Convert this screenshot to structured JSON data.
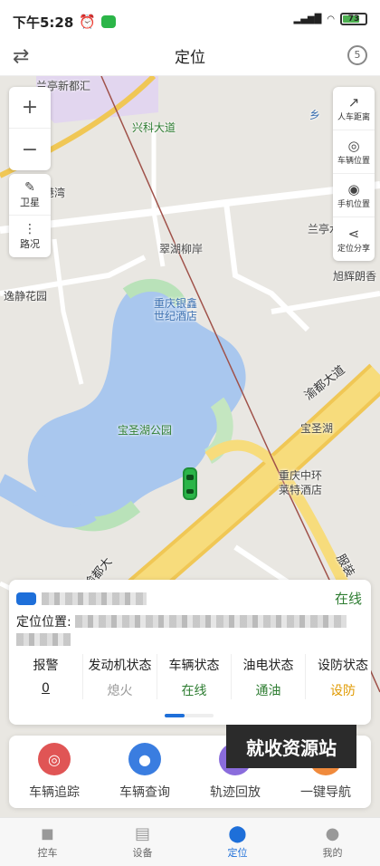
{
  "status_bar": {
    "time": "下午5:28",
    "battery": "73"
  },
  "header": {
    "title": "定位",
    "timer": "5"
  },
  "map_controls": {
    "zoom_in": "+",
    "zoom_out": "−",
    "satellite": "卫星",
    "traffic": "路况"
  },
  "map_right": [
    {
      "label": "人车距离"
    },
    {
      "label": "车辆位置"
    },
    {
      "label": "手机位置"
    },
    {
      "label": "定位分享"
    }
  ],
  "map_labels": {
    "l1": "兰亭新都汇",
    "l2": "兴科大道",
    "l3": "城市港湾",
    "l4": "翠湖柳岸",
    "l5": "兰亭水",
    "l6": "旭辉朗香",
    "l7": "逸静花园",
    "l8": "重庆银鑫",
    "l9": "世纪酒店",
    "l10": "宝圣湖公园",
    "l11": "宝圣湖",
    "l12": "渝都大道",
    "l13": "重庆中环",
    "l14": "莱特酒店",
    "l15": "渝都大",
    "l16": "服装",
    "l17": "乡"
  },
  "info": {
    "status": "在线",
    "location_label": "定位位置:"
  },
  "stats": [
    {
      "label": "报警",
      "value": "0",
      "color": "#222"
    },
    {
      "label": "发动机状态",
      "value": "熄火",
      "color": "#999"
    },
    {
      "label": "车辆状态",
      "value": "在线",
      "color": "#2e7d32"
    },
    {
      "label": "油电状态",
      "value": "通油",
      "color": "#2e7d32"
    },
    {
      "label": "设防状态",
      "value": "设防",
      "color": "#e09a00"
    }
  ],
  "actions": [
    {
      "label": "车辆追踪",
      "color": "#e05555"
    },
    {
      "label": "车辆查询",
      "color": "#3a7de0"
    },
    {
      "label": "轨迹回放",
      "color": "#8a6cdc"
    },
    {
      "label": "一键导航",
      "color": "#f08a3c"
    }
  ],
  "watermark": "就收资源站",
  "tabs": [
    {
      "label": "控车"
    },
    {
      "label": "设备"
    },
    {
      "label": "定位"
    },
    {
      "label": "我的"
    }
  ]
}
